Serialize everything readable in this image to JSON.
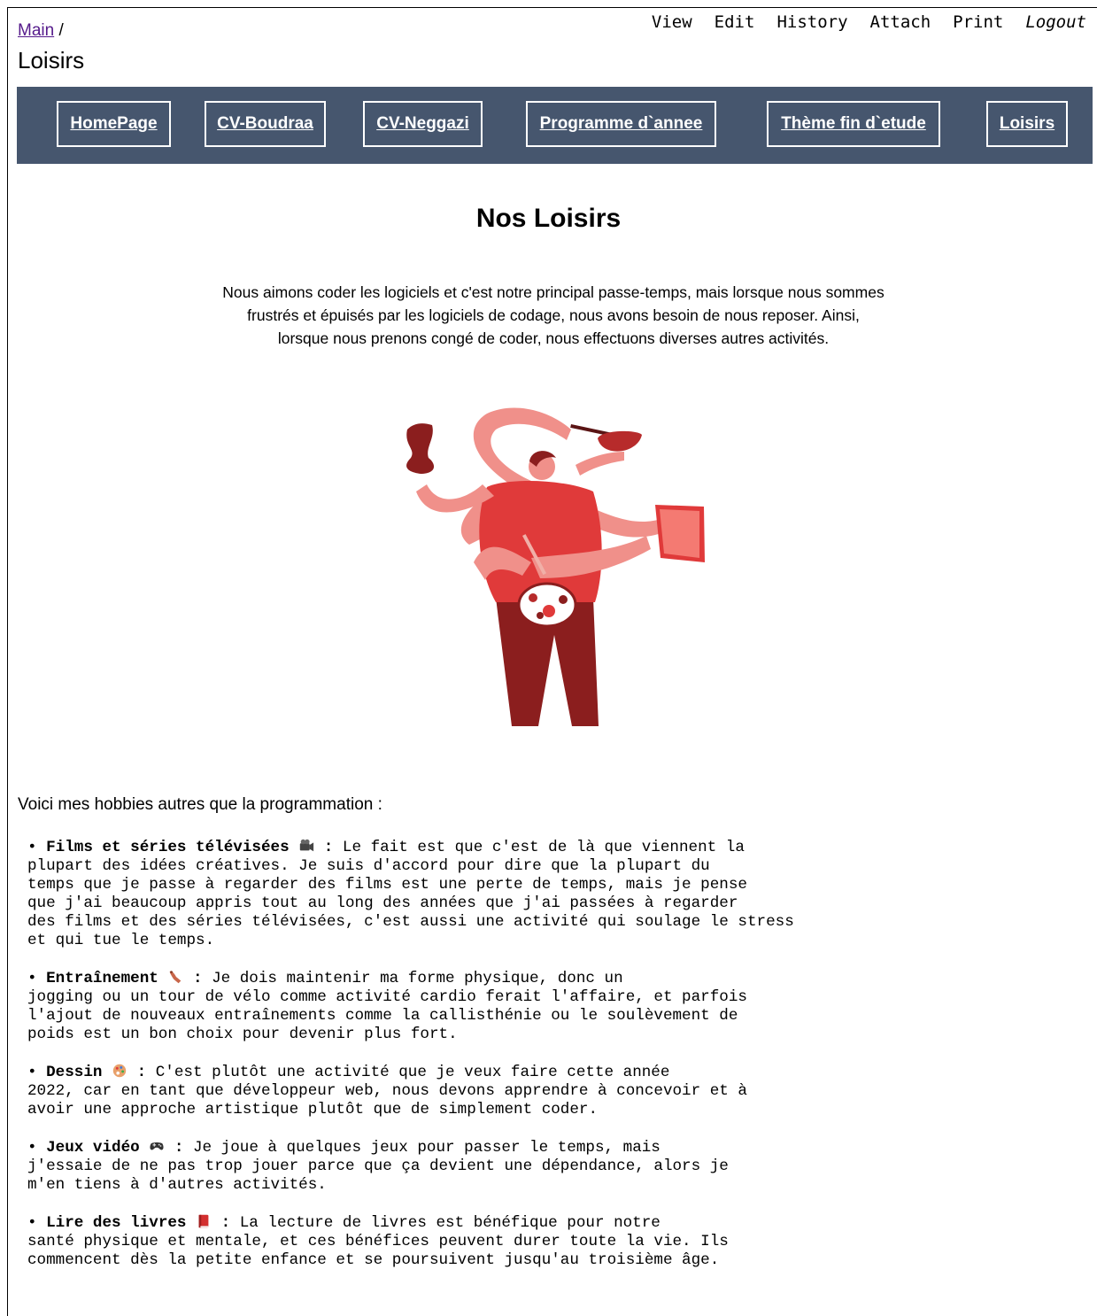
{
  "topnav": {
    "view": "View",
    "edit": "Edit",
    "history": "History",
    "attach": "Attach",
    "print": "Print",
    "logout": "Logout"
  },
  "breadcrumb": {
    "link": "Main",
    "separator": " /"
  },
  "page_title": "Loisirs",
  "menu": [
    {
      "label": "HomePage"
    },
    {
      "label": "CV-Boudraa"
    },
    {
      "label": "CV-Neggazi"
    },
    {
      "label": "Programme d`annee"
    },
    {
      "label": "Thème fin d`etude"
    },
    {
      "label": "Loisirs"
    }
  ],
  "content": {
    "heading": "Nos Loisirs",
    "intro_lines": [
      "Nous aimons coder les logiciels et c'est notre principal passe-temps, mais lorsque nous sommes",
      "frustrés et épuisés par les logiciels de codage, nous avons besoin de nous reposer. Ainsi,",
      "lorsque nous prenons congé de coder, nous effectuons diverses autres activités."
    ],
    "hobbies_intro": "Voici mes hobbies autres que la programmation :",
    "hobbies": [
      {
        "title": "Films et séries télévisées",
        "icon": "movie-camera-icon",
        "text": "Le fait est que c'est de là que viennent la\nplupart des idées créatives. Je suis d'accord pour dire que la plupart du\ntemps que je passe à regarder des films est une perte de temps, mais je pense\nque j'ai beaucoup appris tout au long des années que j'ai passées à regarder\ndes films et des séries télévisées, c'est aussi une activité qui soulage le stress\net qui tue le temps."
      },
      {
        "title": "Entraînement",
        "icon": "flexed-arm-icon",
        "text": "Je dois maintenir ma forme physique, donc un\njogging ou un tour de vélo comme activité cardio ferait l'affaire, et parfois\nl'ajout de nouveaux entraînements comme la callisthénie ou le soulèvement de\npoids est un bon choix pour devenir plus fort."
      },
      {
        "title": "Dessin",
        "icon": "palette-icon",
        "text": "C'est plutôt une activité que je veux faire cette année\n2022, car en tant que développeur web, nous devons apprendre à concevoir et à\navoir une approche artistique plutôt que de simplement coder."
      },
      {
        "title": "Jeux vidéo",
        "icon": "gamepad-icon",
        "text": "Je joue à quelques jeux pour passer le temps, mais\nj'essaie de ne pas trop jouer parce que ça devient une dépendance, alors je\nm'en tiens à d'autres activités."
      },
      {
        "title": "Lire des livres",
        "icon": "red-book-icon",
        "text": "La lecture de livres est bénéfique pour notre\nsanté physique et mentale, et ces bénéfices peuvent durer toute la vie. Ils\ncommencent dès la petite enfance et se poursuivent jusqu'au troisième âge."
      }
    ]
  },
  "colors": {
    "menubar": "#46566e",
    "link": "#551a8b",
    "figure_shirt": "#e03a3a",
    "figure_skin": "#f0908a",
    "figure_pants": "#8b1e1e"
  }
}
